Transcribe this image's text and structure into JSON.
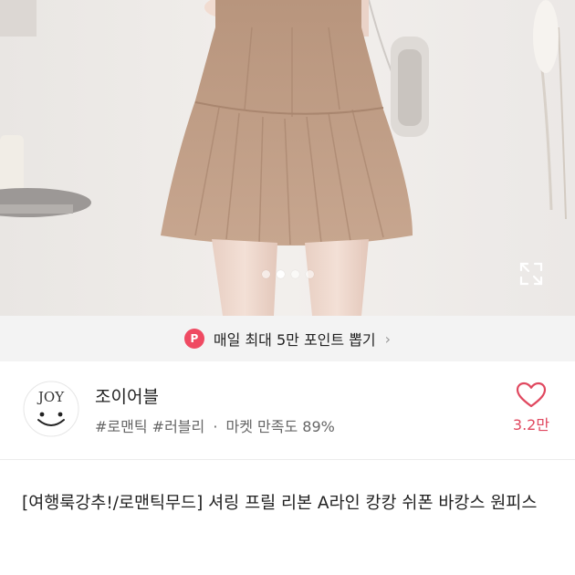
{
  "gallery": {
    "page_indicator": {
      "count": 4,
      "active_index": 1
    },
    "expand_icon": "expand-icon"
  },
  "promo": {
    "badge_text": "P",
    "text": "매일 최대 5만 포인트 뽑기",
    "arrow": "›"
  },
  "shop": {
    "logo_text": "JOY",
    "name": "조이어블",
    "tags": [
      "#로맨틱",
      "#러블리"
    ],
    "separator": "·",
    "satisfaction": "마켓 만족도 89%",
    "like_icon": "heart-icon",
    "like_count": "3.2만"
  },
  "product": {
    "title": "[여행룩강추!/로맨틱무드] 셔링 프릴 리본 A라인 캉캉 쉬폰 바캉스 원피스"
  },
  "colors": {
    "accent": "#e0485f",
    "badge": "#ef4a62",
    "promo_bg": "#f3f3f3",
    "dress": "#c2a089"
  }
}
